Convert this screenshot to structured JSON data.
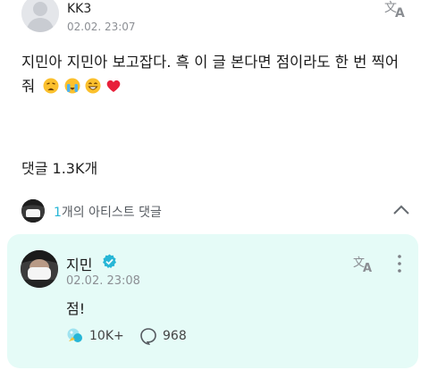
{
  "post": {
    "author": "KK3",
    "time": "02.02. 23:07",
    "text": "지민아 지민아 보고잡다.  흑 이 글 본다면 점이라도 한 번 찍어줘",
    "emojis": [
      "weary-face",
      "loudly-crying-face",
      "grinning-face",
      "red-heart"
    ],
    "translate_icon": "translate-icon"
  },
  "comments": {
    "count_label": "댓글 1.3K개",
    "artist_row": {
      "count": "1",
      "label": "개의 아티스트 댓글",
      "toggle_icon": "chevron-up-icon"
    },
    "artist_comment": {
      "name": "지민",
      "verified_icon": "verified-badge-icon",
      "time": "02.02. 23:08",
      "text": "점!",
      "likes": "10K+",
      "replies": "968",
      "accent_color": "#27b6d6",
      "card_color": "#e5fbf7"
    }
  }
}
